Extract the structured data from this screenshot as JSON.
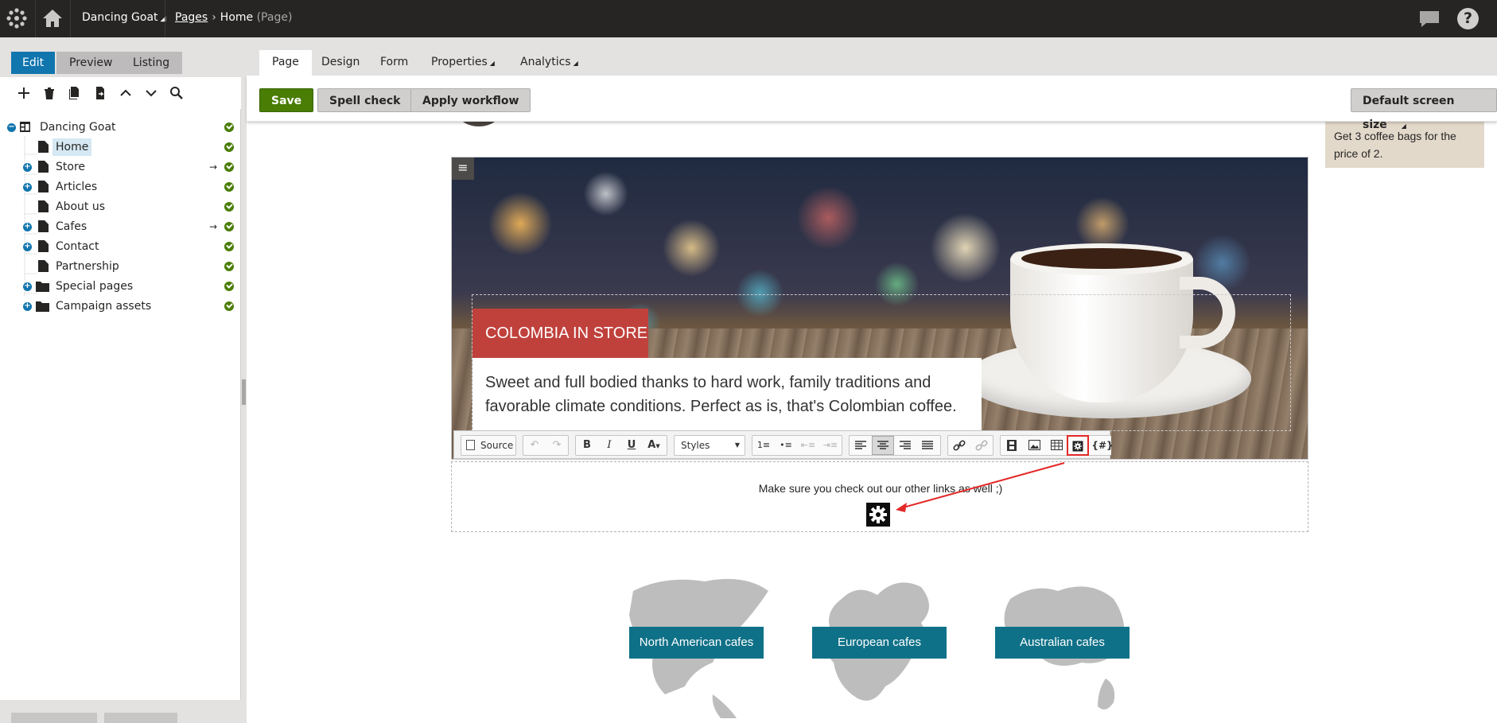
{
  "topbar": {
    "site_name": "Dancing Goat",
    "breadcrumb_link": "Pages",
    "breadcrumb_page": "Home",
    "breadcrumb_type": "(Page)"
  },
  "left_panel": {
    "modes": [
      {
        "label": "Edit",
        "active": true
      },
      {
        "label": "Preview",
        "active": false
      },
      {
        "label": "Listing",
        "active": false
      }
    ],
    "tree": [
      {
        "label": "Dancing Goat",
        "level": 0,
        "expander": "minus",
        "icon": "site-icon",
        "selected": false,
        "arrow": false
      },
      {
        "label": "Home",
        "level": 1,
        "expander": "",
        "icon": "page-icon",
        "selected": true,
        "arrow": false
      },
      {
        "label": "Store",
        "level": 1,
        "expander": "plus",
        "icon": "page-icon",
        "selected": false,
        "arrow": true
      },
      {
        "label": "Articles",
        "level": 1,
        "expander": "plus",
        "icon": "page-icon",
        "selected": false,
        "arrow": false
      },
      {
        "label": "About us",
        "level": 1,
        "expander": "",
        "icon": "page-icon",
        "selected": false,
        "arrow": false
      },
      {
        "label": "Cafes",
        "level": 1,
        "expander": "plus",
        "icon": "page-icon",
        "selected": false,
        "arrow": true
      },
      {
        "label": "Contact",
        "level": 1,
        "expander": "plus",
        "icon": "page-icon",
        "selected": false,
        "arrow": false
      },
      {
        "label": "Partnership",
        "level": 1,
        "expander": "",
        "icon": "page-icon",
        "selected": false,
        "arrow": false
      },
      {
        "label": "Special pages",
        "level": 1,
        "expander": "plus",
        "icon": "folder-icon",
        "selected": false,
        "arrow": false
      },
      {
        "label": "Campaign assets",
        "level": 1,
        "expander": "plus",
        "icon": "folder-icon",
        "selected": false,
        "arrow": false
      }
    ]
  },
  "tabs": [
    {
      "label": "Page",
      "active": true,
      "dropdown": false
    },
    {
      "label": "Design",
      "active": false,
      "dropdown": false
    },
    {
      "label": "Form",
      "active": false,
      "dropdown": false
    },
    {
      "label": "Properties",
      "active": false,
      "dropdown": true
    },
    {
      "label": "Analytics",
      "active": false,
      "dropdown": true
    }
  ],
  "actions": {
    "save": "Save",
    "spell_check": "Spell check",
    "apply_workflow": "Apply workflow",
    "screen_size": "Default screen size"
  },
  "content": {
    "promo": "Get 3 coffee bags for the price of 2.",
    "hero_title": "COLOMBIA IN STORE",
    "hero_text": "Sweet and full bodied thanks to hard work, family traditions and favorable climate conditions. Perfect as is, that's Colombian coffee.",
    "message": "Make sure you check out our other links as well ;)",
    "cafes": [
      "North American cafes",
      "European cafes",
      "Australian cafes"
    ]
  },
  "editor": {
    "source": "Source",
    "styles": "Styles",
    "macro_label": "{#}"
  },
  "colors": {
    "topbar": "#262524",
    "accent_blue": "#1175ae",
    "save_green": "#497d04",
    "hero_red": "#c0413c",
    "cafe_teal": "#0f7188",
    "highlight_red": "#e32929"
  }
}
